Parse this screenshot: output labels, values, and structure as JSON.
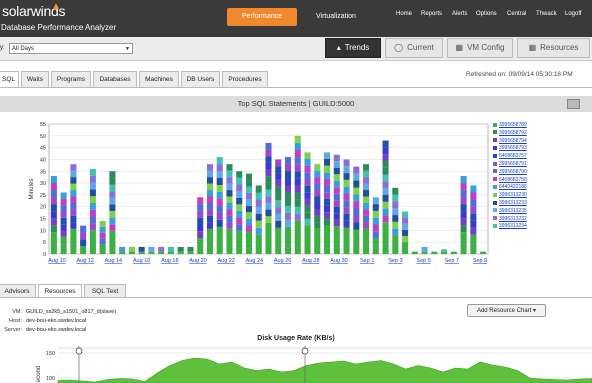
{
  "app": {
    "logo": "solarwinds",
    "product": "Database Performance Analyzer"
  },
  "nav": {
    "performance": "Performance",
    "virtualization": "Virtualization",
    "links": [
      "Home",
      "Reports",
      "Alerts",
      "Options",
      "Central",
      "Thwack",
      "Logoff"
    ]
  },
  "filter": {
    "label": "y:",
    "value": "All Days"
  },
  "views": [
    {
      "label": "Trends",
      "icon": "trend-icon"
    },
    {
      "label": "Current",
      "icon": "clock-icon"
    },
    {
      "label": "VM Config",
      "icon": "monitor-icon"
    },
    {
      "label": "Resources",
      "icon": "monitor-icon"
    }
  ],
  "tabs": [
    "SQL",
    "Waits",
    "Programs",
    "Databases",
    "Machines",
    "DB Users",
    "Procedures"
  ],
  "refreshed": "Refreshed on: 09/09/14 05:30:18 PM",
  "chart_data": {
    "type": "bar",
    "title": "Top SQL Statements | GUILD:5000",
    "ylabel": "Minutes",
    "ylim": [
      0,
      55
    ],
    "yticks": [
      0,
      5,
      10,
      15,
      20,
      25,
      30,
      35,
      40,
      45,
      50,
      55
    ],
    "xtick_labels": [
      "Aug 10",
      "Aug 12",
      "Aug 14",
      "Aug 16",
      "Aug 18",
      "Aug 20",
      "Aug 22",
      "Aug 24",
      "Aug 26",
      "Aug 28",
      "Aug 30",
      "Sep 1",
      "Sep 3",
      "Sep 5",
      "Sep 7",
      "Sep 9"
    ],
    "totals": [
      33,
      26,
      38,
      12,
      36,
      14,
      35,
      3,
      3,
      3,
      3,
      3,
      3,
      3,
      3,
      24,
      38,
      41,
      38,
      35,
      34,
      29,
      47,
      40,
      41,
      50,
      43,
      38,
      43,
      42,
      40,
      37,
      38,
      24,
      48,
      28,
      18,
      1,
      3,
      1,
      2,
      1,
      33,
      29,
      1
    ],
    "series_colors": [
      "#3cb043",
      "#2e8b57",
      "#6f42c1",
      "#3a3ad0",
      "#1f4fb0",
      "#9a4ac6",
      "#4f6ed8",
      "#c040c0",
      "#37a0d8",
      "#7bd14e",
      "#264d9b",
      "#5fa8e8",
      "#8c6fd6",
      "#42c0b0"
    ],
    "legend": [
      "3995658789",
      "3995658792",
      "3995658794",
      "3995658793",
      "6408683757",
      "3995658791",
      "3995658790",
      "6408683758",
      "6440422186",
      "3996313230",
      "3996313233",
      "3996313235",
      "3996313232",
      "3996313234"
    ]
  },
  "bottom_tabs": [
    "Advisors",
    "Resources",
    "SQL Text"
  ],
  "resource": {
    "vm_label": "VM:",
    "vm": "GUILD_ss2k5_s1501_o817_d(slave)",
    "host_label": "Host:",
    "host": "dev-bou-eko.swdev.local",
    "server_label": "Server:",
    "server": "dev-bou-eko.swdev.local"
  },
  "add_button": "Add Resource Chart ▾",
  "disk": {
    "title": "Disk Usage Rate (KB/s)",
    "ylabel": "econd",
    "yticks": [
      150,
      100
    ],
    "values": [
      95,
      96,
      94,
      92,
      97,
      99,
      98,
      93,
      110,
      125,
      135,
      140,
      138,
      128,
      132,
      120,
      115,
      118,
      112,
      115,
      125,
      130,
      132,
      134,
      128,
      132,
      135,
      128,
      118,
      125,
      120,
      112,
      120,
      118,
      132,
      126,
      122,
      115,
      100,
      98,
      97,
      96,
      98,
      99
    ]
  }
}
